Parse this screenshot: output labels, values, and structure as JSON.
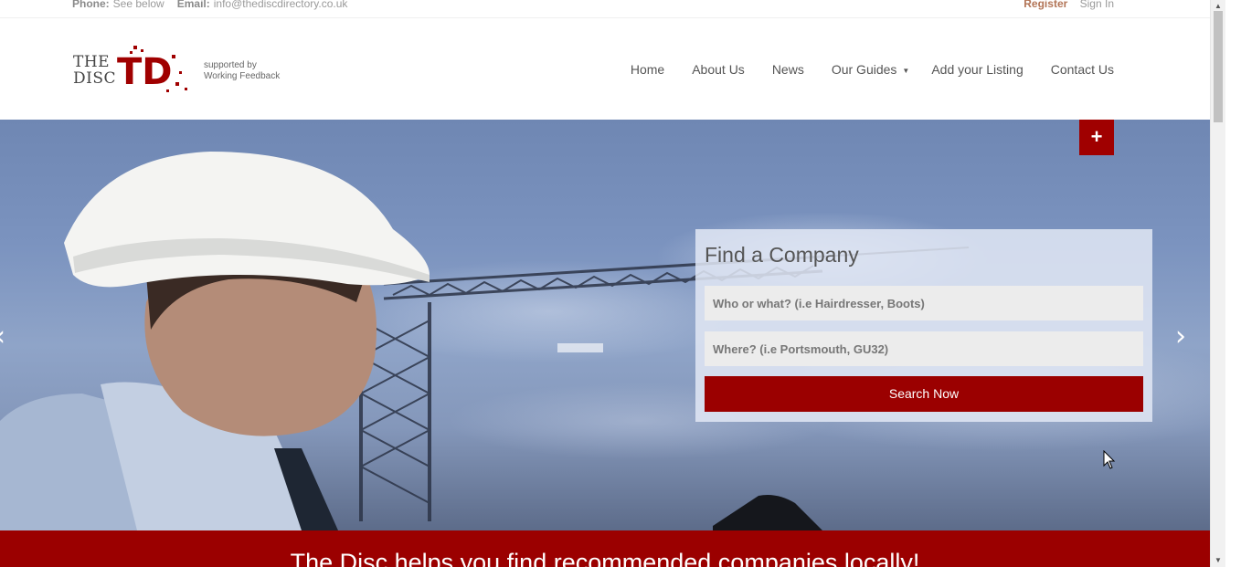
{
  "topbar": {
    "phone_label": "Phone:",
    "phone_value": "See below",
    "email_label": "Email:",
    "email_value": "info@thediscdirectory.co.uk",
    "register": "Register",
    "sign_in": "Sign In"
  },
  "logo": {
    "line1": "THE",
    "line2": "DISC",
    "mark": "TD",
    "supported_line1": "supported by",
    "supported_line2": "Working Feedback"
  },
  "nav": {
    "items": [
      "Home",
      "About Us",
      "News",
      "Our Guides",
      "Add your Listing",
      "Contact Us"
    ]
  },
  "hero": {
    "plus": "+",
    "prev": "‹",
    "next": "›"
  },
  "search": {
    "title": "Find a Company",
    "what_placeholder": "Who or what? (i.e Hairdresser, Boots)",
    "where_placeholder": "Where? (i.e Portsmouth, GU32)",
    "button": "Search Now"
  },
  "band": {
    "tagline": "The Disc helps you find recommended companies locally!"
  },
  "colors": {
    "brand_red": "#9b0000",
    "register_link": "#a0522d"
  }
}
